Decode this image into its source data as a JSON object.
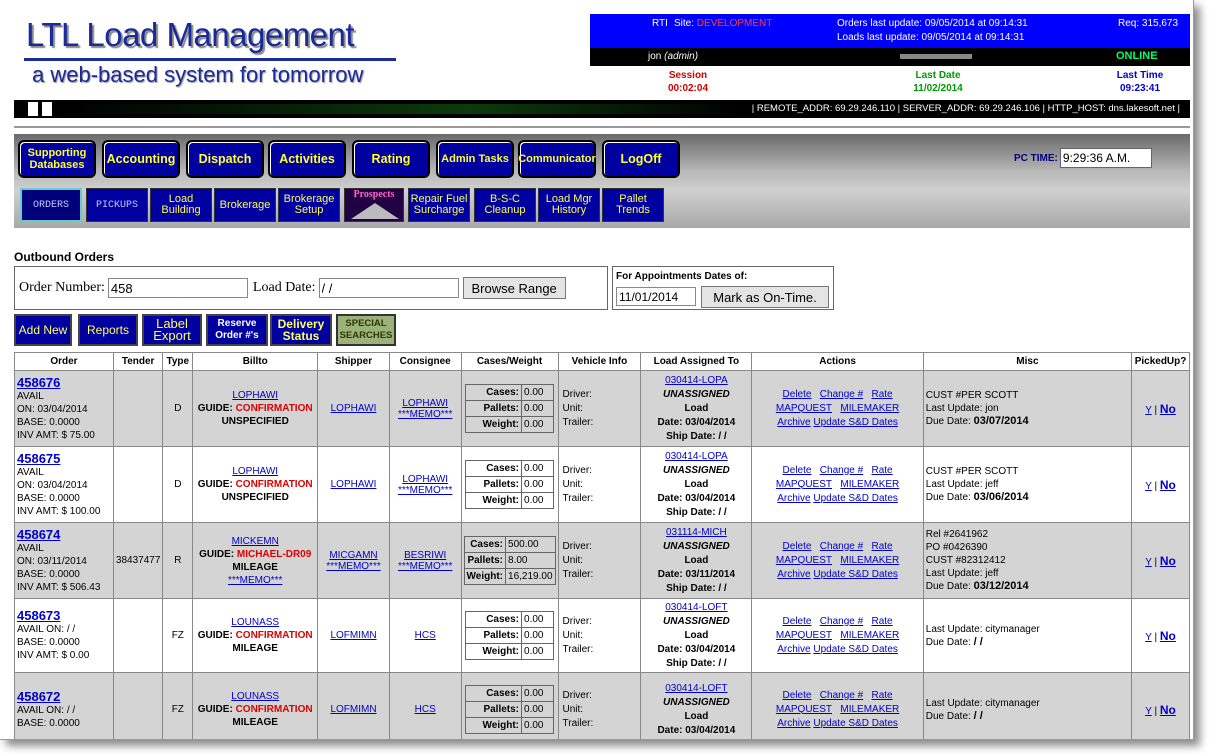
{
  "header": {
    "logo_line1": "LTL Load Management",
    "logo_line2": "a web-based system for tomorrow",
    "rti": "RTI",
    "site_label": "Site:",
    "site_value": "DEVELOPMENT",
    "orders_update": "Orders last update: 09/05/2014 at 09:14:31",
    "loads_update": "Loads last update: 09/05/2014 at 09:14:31",
    "req": "Req: 315,673",
    "user": "jon",
    "role": "(admin)",
    "online": "ONLINE",
    "session_label": "Session",
    "session_value": "00:02:04",
    "lastdate_label": "Last Date",
    "lastdate_value": "11/02/2014",
    "lasttime_label": "Last Time",
    "lasttime_value": "09:23:41",
    "addr": "| REMOTE_ADDR: 69.29.246.110 | SERVER_ADDR: 69.29.246.106 | HTTP_HOST: dns.lakesoft.net |"
  },
  "menu": {
    "main": [
      "Supporting Databases",
      "Accounting",
      "Dispatch",
      "Activities",
      "Rating",
      "Admin Tasks",
      "Communicator",
      "LogOff"
    ],
    "sub": [
      "ORDERS",
      "PICKUPS",
      "Load Building",
      "Brokerage",
      "Brokerage Setup",
      "Prospects",
      "Repair Fuel Surcharge",
      "B-S-C Cleanup",
      "Load Mgr History",
      "Pallet Trends"
    ],
    "pc_time_label": "PC TIME:",
    "pc_time_value": "9:29:36 A.M."
  },
  "orders": {
    "title": "Outbound Orders",
    "order_number_label": "Order Number:",
    "order_number_value": "458",
    "load_date_label": "Load Date:",
    "load_date_value": "/ /",
    "browse_label": "Browse Range",
    "appt_label": "For Appointments Dates of:",
    "appt_value": "11/01/2014",
    "ontime_label": "Mark as On-Time."
  },
  "actions_bar": [
    "Add New",
    "Reports",
    "Label Export",
    "Reserve Order #'s",
    "Delivery Status",
    "SPECIAL SEARCHES"
  ],
  "table": {
    "headers": [
      "Order",
      "Tender",
      "Type",
      "Billto",
      "Shipper",
      "Consignee",
      "Cases/Weight",
      "Vehicle Info",
      "Load Assigned To",
      "Actions",
      "Misc",
      "PickedUp?"
    ],
    "rows": [
      {
        "order": "458676",
        "l1": "AVAIL",
        "l2": "ON: 03/04/2014",
        "l3": "BASE: 0.0000",
        "l4": "INV AMT: $ 75.00",
        "tender": "",
        "type": "D",
        "billto": "LOPHAWI",
        "guide": "CONFIRMATION",
        "b3": "UNSPECIFIED",
        "b4": "",
        "shipper": "LOPHAWI",
        "smemo": "",
        "consignee": "LOPHAWI",
        "cmemo": "***MEMO***",
        "cases": "0.00",
        "pallets": "0.00",
        "weight": "0.00",
        "load": "030414-LOPA",
        "unassigned": "UNASSIGNED",
        "loadword": "Load",
        "date": "Date: 03/04/2014",
        "ship": "Ship Date: / /",
        "m1": "CUST #PER SCOTT",
        "m2": "Last Update: jon",
        "m3": "",
        "m4": "",
        "due": "03/07/2014"
      },
      {
        "order": "458675",
        "l1": "AVAIL",
        "l2": "ON: 03/04/2014",
        "l3": "BASE: 0.0000",
        "l4": "INV AMT: $ 100.00",
        "tender": "",
        "type": "D",
        "billto": "LOPHAWI",
        "guide": "CONFIRMATION",
        "b3": "UNSPECIFIED",
        "b4": "",
        "shipper": "LOPHAWI",
        "smemo": "",
        "consignee": "LOPHAWI",
        "cmemo": "***MEMO***",
        "cases": "0.00",
        "pallets": "0.00",
        "weight": "0.00",
        "load": "030414-LOPA",
        "unassigned": "UNASSIGNED",
        "loadword": "Load",
        "date": "Date: 03/04/2014",
        "ship": "Ship Date: / /",
        "m1": "CUST #PER SCOTT",
        "m2": "Last Update: jeff",
        "m3": "",
        "m4": "",
        "due": "03/06/2014"
      },
      {
        "order": "458674",
        "l1": "AVAIL",
        "l2": "ON: 03/11/2014",
        "l3": "BASE: 0.0000",
        "l4": "INV AMT: $ 506.43",
        "tender": "38437477",
        "type": "R",
        "billto": "MICKEMN",
        "guide": "MICHAEL-DR09",
        "b3": "MILEAGE",
        "b4": "***MEMO***",
        "shipper": "MICGAMN",
        "smemo": "***MEMO***",
        "consignee": "BESRIWI",
        "cmemo": "***MEMO***",
        "cases": "500.00",
        "pallets": "8.00",
        "weight": "16,219.00",
        "load": "031114-MICH",
        "unassigned": "UNASSIGNED",
        "loadword": "Load",
        "date": "Date: 03/11/2014",
        "ship": "Ship Date: / /",
        "m1": "Rel #2641962",
        "m2": "PO #0426390",
        "m3": "CUST #82312412",
        "m4": "Last Update: jeff",
        "due": "03/12/2014"
      },
      {
        "order": "458673",
        "l1": "AVAIL ON: / /",
        "l2": "BASE: 0.0000",
        "l3": "INV AMT: $ 0.00",
        "l4": "",
        "tender": "",
        "type": "FZ",
        "billto": "LOUNASS",
        "guide": "CONFIRMATION",
        "b3": "MILEAGE",
        "b4": "",
        "shipper": "LOFMIMN",
        "smemo": "",
        "consignee": "HCS",
        "cmemo": "",
        "cases": "0.00",
        "pallets": "0.00",
        "weight": "0.00",
        "load": "030414-LOFT",
        "unassigned": "UNASSIGNED",
        "loadword": "Load",
        "date": "Date: 03/04/2014",
        "ship": "Ship Date: / /",
        "m1": "Last Update: citymanager",
        "m2": "",
        "m3": "",
        "m4": "",
        "due": "/ /"
      },
      {
        "order": "458672",
        "l1": "AVAIL ON: / /",
        "l2": "BASE: 0.0000",
        "l3": "",
        "l4": "",
        "tender": "",
        "type": "FZ",
        "billto": "LOUNASS",
        "guide": "CONFIRMATION",
        "b3": "MILEAGE",
        "b4": "",
        "shipper": "LOFMIMN",
        "smemo": "",
        "consignee": "HCS",
        "cmemo": "",
        "cases": "0.00",
        "pallets": "0.00",
        "weight": "0.00",
        "load": "030414-LOFT",
        "unassigned": "UNASSIGNED",
        "loadword": "Load",
        "date": "Date: 03/04/2014",
        "ship": "",
        "m1": "Last Update: citymanager",
        "m2": "",
        "m3": "",
        "m4": "",
        "due": "/ /"
      }
    ],
    "labels": {
      "guide": "GUIDE:",
      "cases": "Cases:",
      "pallets": "Pallets:",
      "weight": "Weight:",
      "driver": "Driver:",
      "unit": "Unit:",
      "trailer": "Trailer:",
      "delete": "Delete",
      "change": "Change #",
      "rate": "Rate",
      "mapquest": "MAPQUEST",
      "milemaker": "MILEMAKER",
      "archive": "Archive",
      "update": "Update S&D Dates",
      "due": "Due Date:",
      "y": "Y",
      "sep": "|",
      "no": "No"
    }
  }
}
